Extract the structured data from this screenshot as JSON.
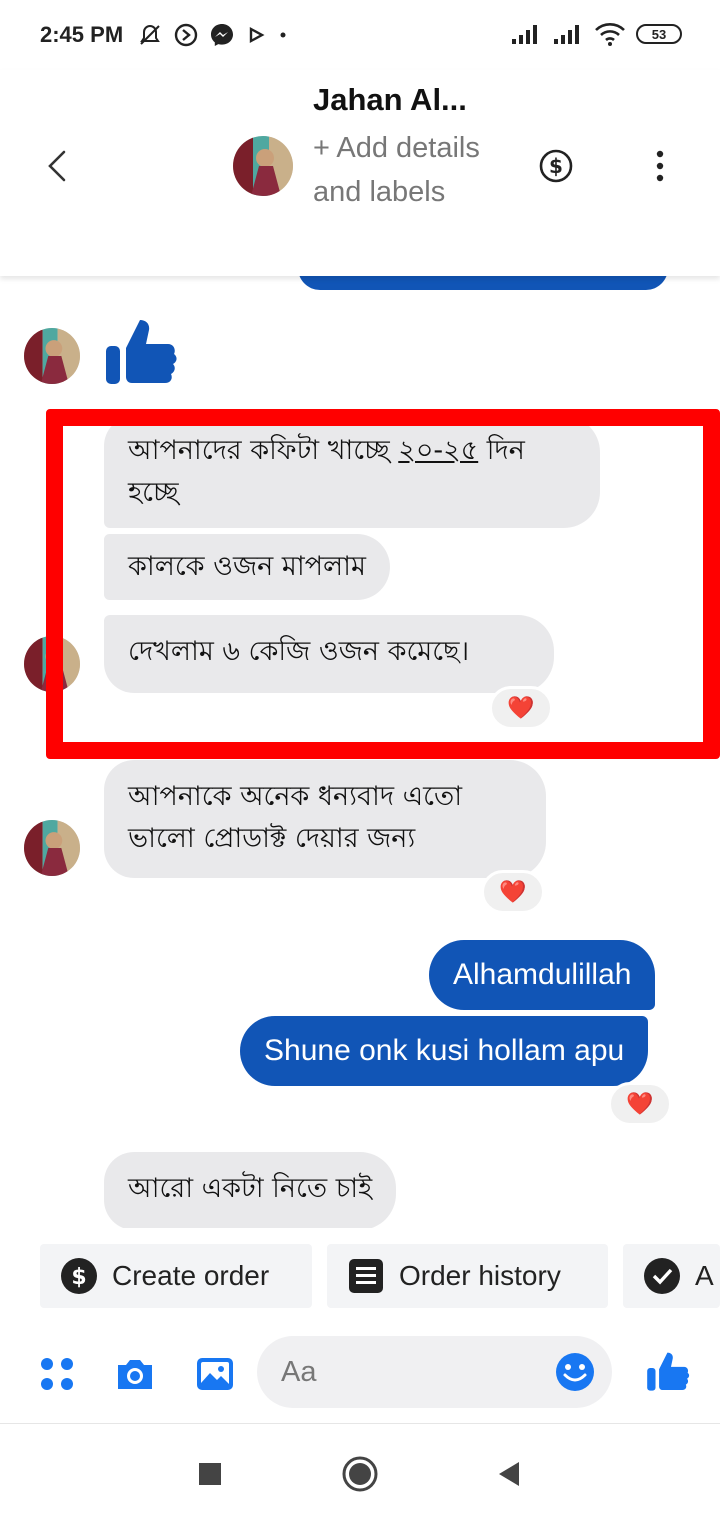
{
  "status_bar": {
    "time": "2:45 PM",
    "battery": "53",
    "icons_left": [
      "silent-icon",
      "scroll-icon",
      "messenger-icon",
      "play-icon",
      "dot-icon"
    ],
    "icons_right": [
      "signal-icon",
      "signal-icon",
      "wifi-icon",
      "battery-icon"
    ]
  },
  "header": {
    "contact_name": "Jahan Al...",
    "subtitle": "+ Add details and labels",
    "back_icon": "chevron-left-icon",
    "dollar_icon": "dollar-circle-icon",
    "more_icon": "more-vertical-icon"
  },
  "messages": [
    {
      "type": "like",
      "direction": "in"
    },
    {
      "direction": "in",
      "text_pre": "আপনাদের কফিটা খাচ্ছে ",
      "text_underlined": "২০-২৫",
      "text_post": " দিন হচ্ছে"
    },
    {
      "direction": "in",
      "text": "কালকে ওজন মাপলাম"
    },
    {
      "direction": "in",
      "text": "দেখলাম ৬ কেজি ওজন কমেছে।",
      "reaction": "❤️"
    },
    {
      "direction": "in",
      "text": "আপনাকে অনেক ধন্যবাদ এতো ভালো প্রোডাক্ট দেয়ার জন্য",
      "reaction": "❤️"
    },
    {
      "direction": "out",
      "text": "Alhamdulillah"
    },
    {
      "direction": "out",
      "text": "Shune onk kusi hollam apu",
      "reaction": "❤️"
    },
    {
      "direction": "in",
      "text": "আরো একটা নিতে চাই"
    }
  ],
  "quick_actions": [
    {
      "label": "Create order",
      "icon": "dollar-circle-icon"
    },
    {
      "label": "Order history",
      "icon": "list-icon"
    },
    {
      "label": "A",
      "icon": "check-circle-icon"
    }
  ],
  "composer": {
    "placeholder": "Aa",
    "icons": [
      "apps-icon",
      "camera-icon",
      "image-icon",
      "emoji-icon",
      "like-icon"
    ]
  },
  "nav_bar": {
    "icons": [
      "recents-icon",
      "home-icon",
      "back-icon"
    ]
  },
  "colors": {
    "accent": "#1155b6",
    "incoming_bubble": "#e9e9eb",
    "highlight": "#ff0000",
    "heart": "#e0182d"
  }
}
